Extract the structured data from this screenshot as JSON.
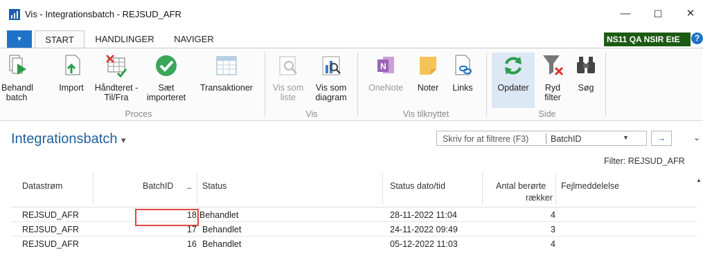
{
  "window": {
    "title": "Vis - Integrationsbatch - REJSUD_AFR",
    "minimize": "—",
    "maximize": "☐",
    "close": "✕"
  },
  "tabs": {
    "file_glyph": "▼",
    "start": "START",
    "handlinger": "HANDLINGER",
    "naviger": "NAVIGER",
    "company": "NS11 QA NSIR EtE",
    "help": "?"
  },
  "ribbon": {
    "buttons": [
      {
        "label": "Behandl batch",
        "icon": "process-batch-icon"
      },
      {
        "label": "Import",
        "icon": "import-icon"
      },
      {
        "label": "Håndteret - Til/Fra",
        "icon": "handled-toggle-icon"
      },
      {
        "label": "Sæt importeret",
        "icon": "checkmark-icon"
      },
      {
        "label": "Transaktioner",
        "icon": "transactions-icon"
      },
      {
        "label": "Vis som liste",
        "icon": "list-view-icon",
        "disabled": true
      },
      {
        "label": "Vis som diagram",
        "icon": "chart-view-icon"
      },
      {
        "label": "OneNote",
        "icon": "onenote-icon",
        "disabled": true
      },
      {
        "label": "Noter",
        "icon": "notes-icon"
      },
      {
        "label": "Links",
        "icon": "links-icon"
      },
      {
        "label": "Opdater",
        "icon": "refresh-icon"
      },
      {
        "label": "Ryd filter",
        "icon": "clear-filter-icon"
      },
      {
        "label": "Søg",
        "icon": "binoculars-icon"
      }
    ],
    "groups": [
      "Proces",
      "Vis",
      "Vis tilknyttet",
      "Side"
    ]
  },
  "page": {
    "title": "Integrationsbatch",
    "title_caret": "▾",
    "filter_placeholder": "Skriv for at filtrere (F3)",
    "filter_field": "BatchID",
    "filter_dropdown": "▼",
    "filter_go": "→",
    "collapse": "⌄",
    "active_filter": "Filter: REJSUD_AFR"
  },
  "table": {
    "headers": {
      "datastrom": "Datastrøm",
      "batchid": "BatchID",
      "status": "Status",
      "status_date": "Status dato/tid",
      "rows_affected_1": "Antal berørte",
      "rows_affected_2": "rækker",
      "error": "Fejlmeddelelse"
    },
    "sort_indicator": "▁",
    "rows": [
      {
        "datastrom": "REJSUD_AFR",
        "batchid": "18",
        "status": "Behandlet",
        "date": "28-11-2022 11:04",
        "count": "4",
        "error": ""
      },
      {
        "datastrom": "REJSUD_AFR",
        "batchid": "17",
        "status": "Behandlet",
        "date": "24-11-2022 09:49",
        "count": "3",
        "error": ""
      },
      {
        "datastrom": "REJSUD_AFR",
        "batchid": "16",
        "status": "Behandlet",
        "date": "05-12-2022 11:03",
        "count": "4",
        "error": ""
      }
    ]
  },
  "colors": {
    "accent": "#1e73c8",
    "company_bg": "#1d5a14",
    "highlight": "#e0473f",
    "title_blue": "#1e5f9e"
  }
}
